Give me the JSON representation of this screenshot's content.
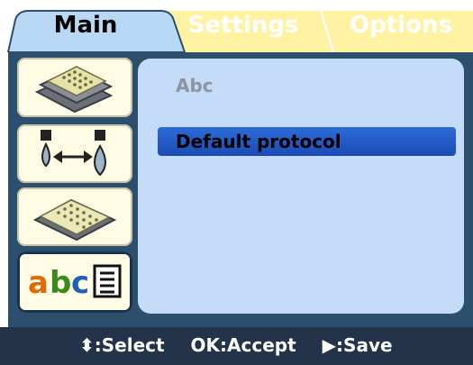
{
  "tabs": {
    "main": "Main",
    "settings": "Settings",
    "options": "Options"
  },
  "sidebar": {
    "items": [
      {
        "name": "plate-stack",
        "icon": "plate-stack-icon"
      },
      {
        "name": "dispense",
        "icon": "dispense-transfer-icon"
      },
      {
        "name": "wellplate",
        "icon": "wellplate-icon"
      },
      {
        "name": "protocol-name",
        "icon": "abc-list-icon",
        "selected": true
      }
    ]
  },
  "content": {
    "label": "Abc",
    "selected_item": "Default protocol"
  },
  "statusbar": {
    "select_symbol": "⬍",
    "select_label": ":Select",
    "accept_label": "OK:Accept",
    "save_symbol": "▶",
    "save_label": ":Save"
  },
  "colors": {
    "active_tab": "#b9d8f6",
    "inactive_tab": "#fff2a3",
    "panel": "#2c4f6e",
    "content_bg": "#c4dcf8",
    "highlight": "#2d6bd8",
    "statusbar": "#23344a"
  }
}
